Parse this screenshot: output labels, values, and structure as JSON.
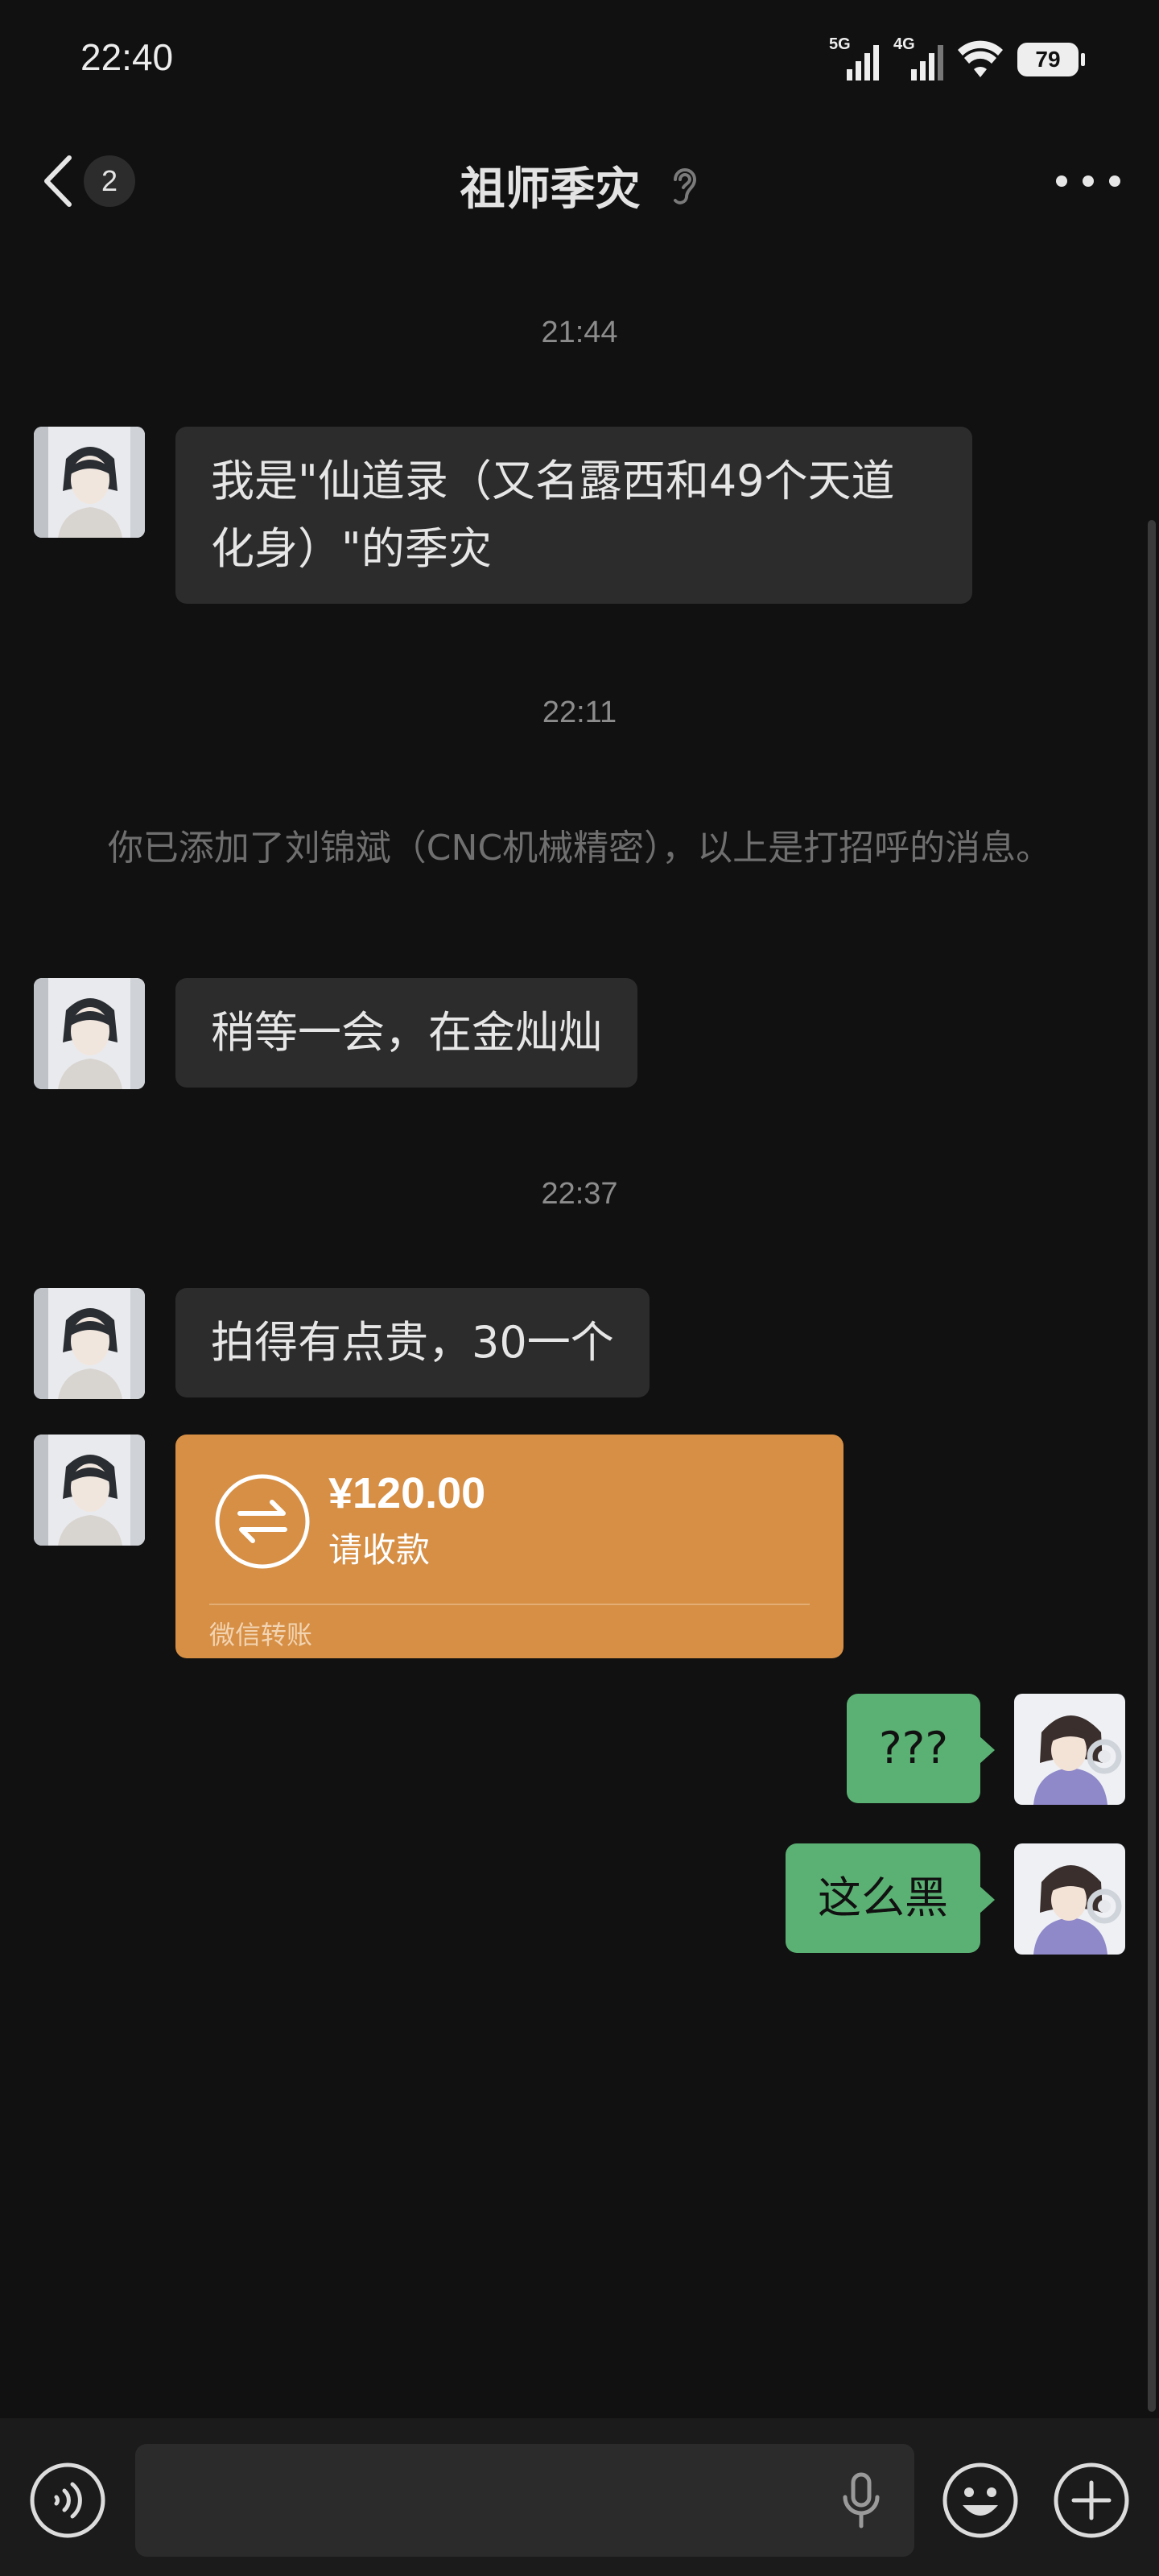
{
  "status_bar": {
    "time": "22:40",
    "sim1_label": "5G",
    "sim2_label": "4G",
    "battery": "79"
  },
  "header": {
    "unread_count": "2",
    "title": "祖师季灾"
  },
  "messages": {
    "timestamp_1": "21:44",
    "msg_1": "我是\"仙道录（又名露西和49个天道化身）\"的季灾",
    "timestamp_2": "22:11",
    "system_notice": "你已添加了刘锦斌（CNC机械精密），以上是打招呼的消息。",
    "msg_2": "稍等一会，在金灿灿",
    "timestamp_3": "22:37",
    "msg_3": "拍得有点贵，30一个",
    "transfer": {
      "amount": "¥120.00",
      "status": "请收款",
      "footer": "微信转账"
    },
    "out_1": "???",
    "out_2": "这么黑"
  },
  "colors": {
    "background": "#111111",
    "bubble_incoming": "#2c2c2c",
    "bubble_outgoing": "#5bb173",
    "transfer_card": "#d68f45"
  },
  "icons": [
    "back-arrow-icon",
    "ear-icon",
    "more-dots-icon",
    "transfer-arrows-icon",
    "voice-icon",
    "microphone-icon",
    "emoji-icon",
    "plus-icon"
  ]
}
